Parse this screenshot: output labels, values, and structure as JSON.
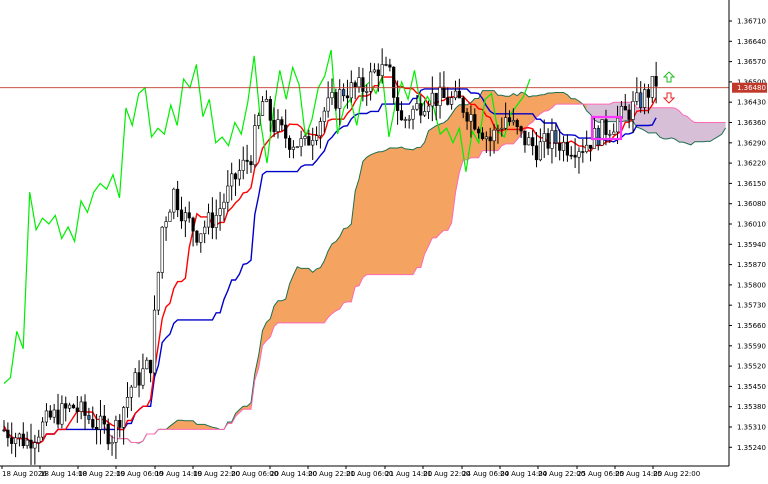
{
  "chart_data": {
    "type": "candlestick",
    "title": "",
    "ylim": [
      1.3518,
      1.3676
    ],
    "y_ticks": [
      "1.36710",
      "1.36640",
      "1.36570",
      "1.36500",
      "1.36430",
      "1.36360",
      "1.36290",
      "1.36220",
      "1.36150",
      "1.36080",
      "1.36010",
      "1.35940",
      "1.35870",
      "1.35800",
      "1.35730",
      "1.35660",
      "1.35590",
      "1.35520",
      "1.35450",
      "1.35380",
      "1.35310",
      "1.35240"
    ],
    "x_ticks": [
      "18 Aug 2026",
      "18 Aug 14:00",
      "18 Aug 22:00",
      "19 Aug 06:00",
      "19 Aug 14:00",
      "19 Aug 22:00",
      "20 Aug 06:00",
      "20 Aug 14:00",
      "20 Aug 22:00",
      "21 Aug 06:00",
      "21 Aug 14:00",
      "21 Aug 22:00",
      "24 Aug 06:00",
      "24 Aug 14:00",
      "24 Aug 22:00",
      "25 Aug 06:00",
      "25 Aug 14:00",
      "25 Aug 22:00"
    ],
    "current_price": "1.36480",
    "current_price_value": 1.3648,
    "colors": {
      "bull": "#ffffff",
      "bear": "#000000",
      "bear_alt": "#2a5fa8",
      "tenkan": "#ff0000",
      "kijun": "#0000cc",
      "chikou": "#00ee00",
      "cloud_bull": "#f4a460",
      "cloud_bear": "#d8bfd8",
      "senkou_a": "#1f6f4f",
      "senkou_b": "#ff69b4",
      "price_line": "#c0392b",
      "highlight": "#ff33ff",
      "arrow_up": "#22bb22",
      "arrow_down": "#ee2222"
    },
    "series": [
      {
        "name": "Chikou",
        "values": [
          1.3546,
          1.3548,
          1.3564,
          1.3558,
          1.3612,
          1.3599,
          1.3603,
          1.3601,
          1.3604,
          1.3596,
          1.36,
          1.3595,
          1.3609,
          1.3605,
          1.3612,
          1.3615,
          1.3613,
          1.3618,
          1.361,
          1.3641,
          1.3635,
          1.3646,
          1.3648,
          1.3631,
          1.3634,
          1.3632,
          1.3642,
          1.3635,
          1.3651,
          1.3648,
          1.3656,
          1.3638,
          1.3644,
          1.3629,
          1.3631,
          1.3628,
          1.3636,
          1.3632,
          1.3643,
          1.3659,
          1.3636,
          1.3622,
          1.364,
          1.3654,
          1.3644,
          1.3655,
          1.3649,
          1.3631,
          1.3637,
          1.3648,
          1.3652,
          1.3661,
          1.3632,
          1.3641,
          1.3644,
          1.3635,
          1.3648,
          1.365,
          1.3646,
          1.3652,
          1.3631,
          1.3642,
          1.365,
          1.3644,
          1.3654,
          1.3641,
          1.3645,
          1.3641,
          1.3632,
          1.3634,
          1.3629,
          1.3634,
          1.3619,
          1.3633,
          1.3629,
          1.3644,
          1.3646,
          1.3633,
          1.3631,
          1.3639,
          1.3642,
          1.3645,
          1.3651
        ]
      }
    ]
  },
  "labels": {
    "price_tag": "1.36480"
  }
}
